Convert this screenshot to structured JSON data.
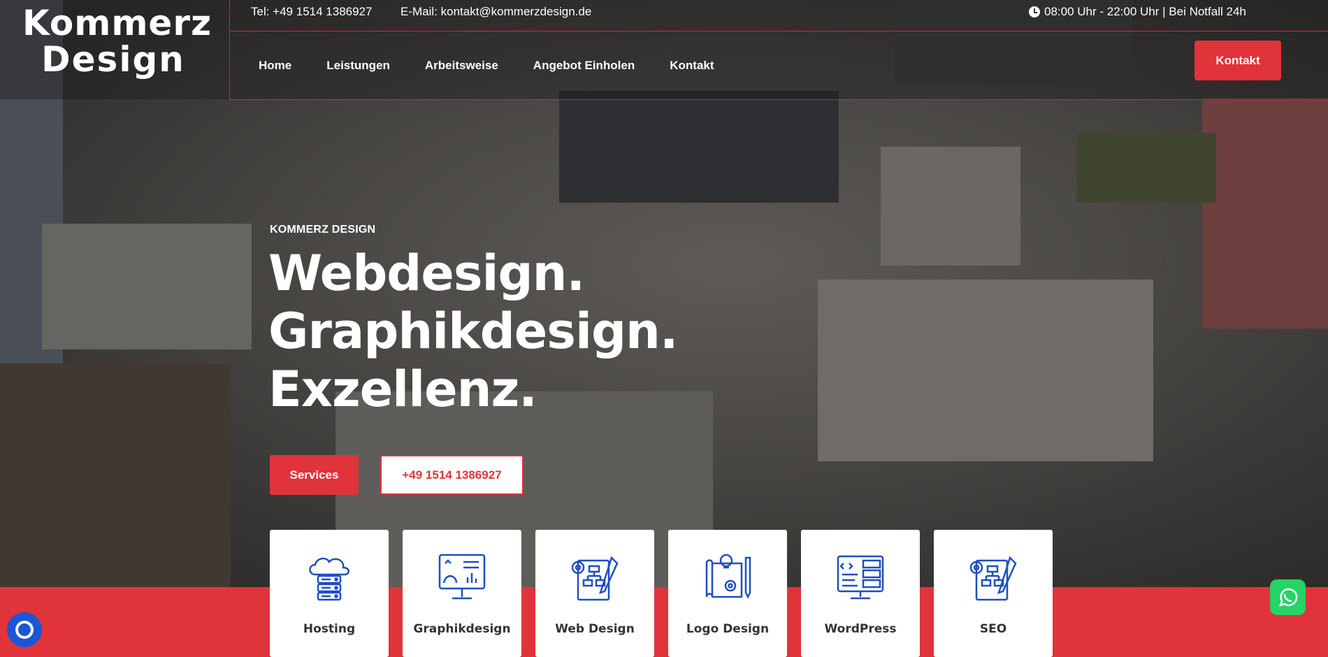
{
  "brand": {
    "logo_line1": "Kommerz",
    "logo_line2": "Design"
  },
  "topbar": {
    "tel": "Tel: +49 1514 1386927",
    "email": "E-Mail: kontakt@kommerzdesign.de",
    "hours": "08:00 Uhr - 22:00 Uhr | Bei Notfall 24h"
  },
  "nav": {
    "items": [
      {
        "label": "Home"
      },
      {
        "label": "Leistungen"
      },
      {
        "label": "Arbeitsweise"
      },
      {
        "label": "Angebot Einholen"
      },
      {
        "label": "Kontakt"
      }
    ],
    "cta_label": "Kontakt"
  },
  "hero": {
    "eyebrow": "KOMMERZ DESIGN",
    "headline": [
      "Webdesign.",
      "Graphikdesign.",
      "Exzellenz."
    ],
    "btn_services": "Services",
    "btn_phone": "+49 1514 1386927"
  },
  "services": [
    {
      "label": "Hosting",
      "icon": "server-cloud-icon"
    },
    {
      "label": "Graphikdesign",
      "icon": "monitor-design-icon"
    },
    {
      "label": "Web Design",
      "icon": "sitemap-gear-icon"
    },
    {
      "label": "Logo Design",
      "icon": "blueprint-idea-icon"
    },
    {
      "label": "WordPress",
      "icon": "code-server-icon"
    },
    {
      "label": "SEO",
      "icon": "sitemap-gear-icon"
    }
  ],
  "colors": {
    "accent": "#e1333a",
    "icon_blue": "#1f4fbf",
    "whatsapp": "#25d366",
    "cookie": "#1a56d6"
  }
}
